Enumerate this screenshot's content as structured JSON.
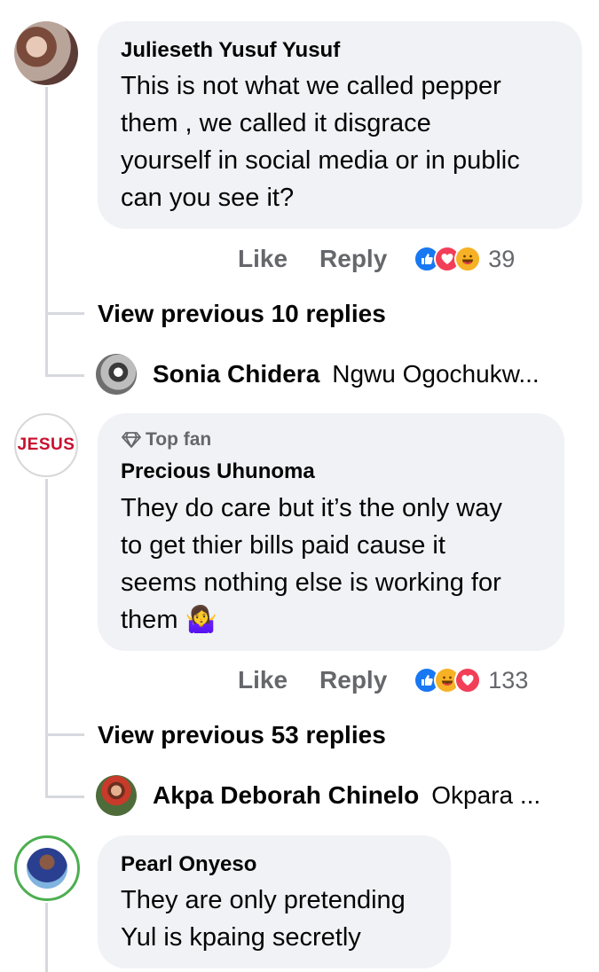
{
  "comments": [
    {
      "author": "Julieseth Yusuf Yusuf",
      "lines": [
        "This is not what we called pepper",
        "them , we called it disgrace",
        "yourself in social media or in public",
        "can you see it?"
      ],
      "like": "Like",
      "reply": "Reply",
      "reaction_count": "39",
      "reactions": [
        "like",
        "love",
        "haha"
      ],
      "view_previous": "View previous 10 replies",
      "latest_reply": {
        "author": "Sonia Chidera",
        "text": "Ngwu Ogochukw..."
      }
    },
    {
      "badge": "Top fan",
      "author": "Precious Uhunoma",
      "avatar_text": "JESUS",
      "lines": [
        "They do care but it’s the only way",
        "to get thier bills paid cause it",
        "seems nothing else is working for",
        "them 🤷‍♀️"
      ],
      "like": "Like",
      "reply": "Reply",
      "reaction_count": "133",
      "reactions": [
        "like",
        "haha",
        "love"
      ],
      "view_previous": "View previous 53 replies",
      "latest_reply": {
        "author": "Akpa Deborah Chinelo",
        "text": "Okpara ..."
      }
    },
    {
      "author": "Pearl Onyeso",
      "lines": [
        "They are only pretending",
        "Yul is kpaing secretly"
      ]
    }
  ],
  "colors": {
    "bubble": "#f0f2f5",
    "secondary_text": "#65676b",
    "like_blue": "#1877f2",
    "love_red": "#f33e58",
    "haha_yellow": "#f7b125"
  }
}
